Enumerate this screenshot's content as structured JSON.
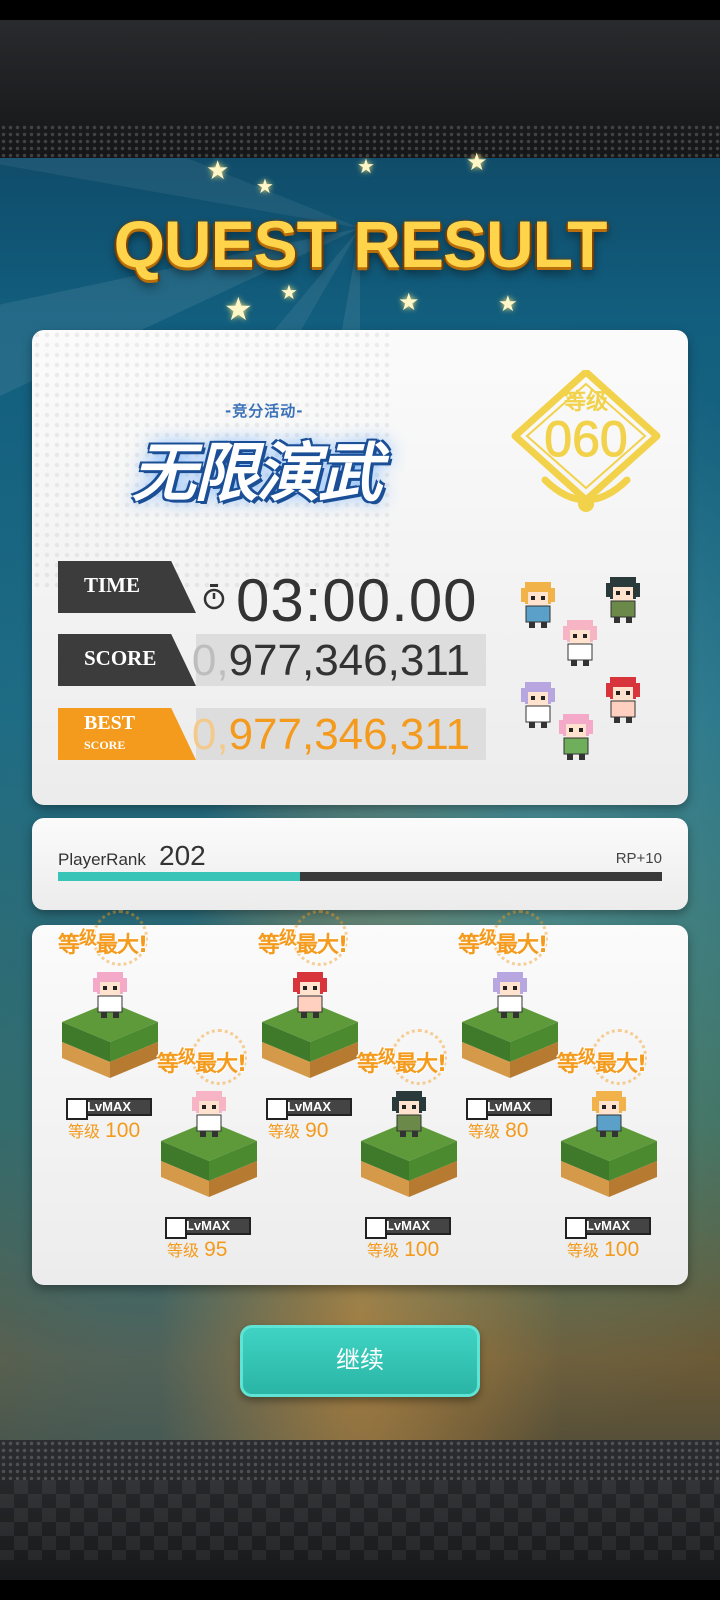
{
  "header": {
    "title": "QUEST RESULT"
  },
  "event": {
    "subtitle": "-竞分活动-",
    "name": "无限演武"
  },
  "level": {
    "label": "等级",
    "value": "060"
  },
  "stats": {
    "time_label": "TIME",
    "time_value": "03:00.00",
    "score_label": "SCORE",
    "score_prefix": "0,",
    "score_value": "977,346,311",
    "best_label_top": "BEST",
    "best_label_bottom": "SCORE",
    "best_prefix": "0,",
    "best_value": "977,346,311"
  },
  "player_rank": {
    "label": "PlayerRank",
    "value": "202",
    "rp_text": "RP+10",
    "progress": 0.4
  },
  "characters": [
    {
      "burst_main": "等",
      "burst_sup": "级",
      "burst_tail": "最大!",
      "badge": "LvMAX",
      "level_label": "等级",
      "level": "100",
      "hair": "#f4a9c8",
      "body": "#ffffff"
    },
    {
      "burst_main": "等",
      "burst_sup": "级",
      "burst_tail": "最大!",
      "badge": "LvMAX",
      "level_label": "等级",
      "level": "95",
      "hair": "#f7b4c4",
      "body": "#ffffff"
    },
    {
      "burst_main": "等",
      "burst_sup": "级",
      "burst_tail": "最大!",
      "badge": "LvMAX",
      "level_label": "等级",
      "level": "90",
      "hair": "#d8343c",
      "body": "#ffd0c0"
    },
    {
      "burst_main": "等",
      "burst_sup": "级",
      "burst_tail": "最大!",
      "badge": "LvMAX",
      "level_label": "等级",
      "level": "100",
      "hair": "#2a3a3a",
      "body": "#6b8a4a"
    },
    {
      "burst_main": "等",
      "burst_sup": "级",
      "burst_tail": "最大!",
      "badge": "LvMAX",
      "level_label": "等级",
      "level": "80",
      "hair": "#b8a6e0",
      "body": "#ffffff"
    },
    {
      "burst_main": "等",
      "burst_sup": "级",
      "burst_tail": "最大!",
      "badge": "LvMAX",
      "level_label": "等级",
      "level": "100",
      "hair": "#f2b24a",
      "body": "#5aa0c8"
    }
  ],
  "party_sprites": [
    {
      "name": "party-sprite-1",
      "hair": "#f2b24a",
      "body": "#5aa0c8"
    },
    {
      "name": "party-sprite-2",
      "hair": "#2a3a3a",
      "body": "#6b8a4a"
    },
    {
      "name": "party-sprite-3",
      "hair": "#f7b4c4",
      "body": "#ffffff"
    },
    {
      "name": "party-sprite-4",
      "hair": "#b8a6e0",
      "body": "#ffffff"
    },
    {
      "name": "party-sprite-5",
      "hair": "#d8343c",
      "body": "#ffd0c0"
    },
    {
      "name": "party-sprite-6",
      "hair": "#f4a9c8",
      "body": "#6fae5a"
    }
  ],
  "buttons": {
    "continue": "继续"
  },
  "colors": {
    "accent_orange": "#f49a1c",
    "teal": "#38c4b6",
    "gold": "#ffd44a"
  }
}
